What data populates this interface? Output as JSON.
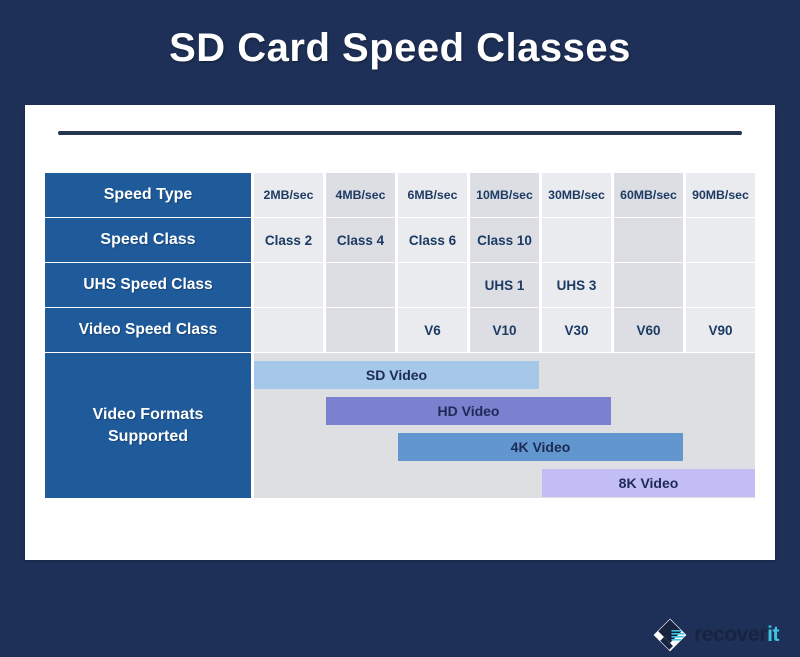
{
  "poster": {
    "title": "SD Card Speed Classes",
    "background_color": "#1e3057",
    "card_color": "#ffffff",
    "rule_color": "#25364d",
    "label_color": "#1f5b9b"
  },
  "table": {
    "rows": [
      {
        "label": "Speed Type",
        "cells": [
          "2MB/sec",
          "4MB/sec",
          "6MB/sec",
          "10MB/sec",
          "30MB/sec",
          "60MB/sec",
          "90MB/sec"
        ]
      },
      {
        "label": "Speed Class",
        "cells": [
          "Class 2",
          "Class 4",
          "Class 6",
          "Class 10",
          "",
          "",
          ""
        ]
      },
      {
        "label": "UHS Speed Class",
        "cells": [
          "",
          "",
          "",
          "UHS 1",
          "UHS 3",
          "",
          ""
        ]
      },
      {
        "label": "Video Speed Class",
        "cells": [
          "",
          "",
          "V6",
          "V10",
          "V30",
          "V60",
          "V90"
        ]
      }
    ]
  },
  "video_formats": {
    "label": "Video Formats\nSupported",
    "label_line1": "Video Formats",
    "label_line2": "Supported",
    "bars": [
      {
        "name": "SD Video",
        "start_col": 1,
        "end_col": 4,
        "color": "#a5c7e8"
      },
      {
        "name": "HD Video",
        "start_col": 2,
        "end_col": 5,
        "color": "#7b80cf"
      },
      {
        "name": "4K Video",
        "start_col": 3,
        "end_col": 6,
        "color": "#6296cf"
      },
      {
        "name": "8K Video",
        "start_col": 5,
        "end_col": 7,
        "color": "#c2bdf5"
      }
    ]
  },
  "logo": {
    "name_primary": "recover",
    "name_accent": "it",
    "mark_color": "#18243f",
    "accent_color": "#3ec6e0"
  },
  "chart_data": {
    "type": "table",
    "title": "SD Card Speed Classes",
    "categories": [
      "2MB/sec",
      "4MB/sec",
      "6MB/sec",
      "10MB/sec",
      "30MB/sec",
      "60MB/sec",
      "90MB/sec"
    ],
    "series": [
      {
        "name": "Speed Class",
        "values": [
          "Class 2",
          "Class 4",
          "Class 6",
          "Class 10",
          "",
          "",
          ""
        ]
      },
      {
        "name": "UHS Speed Class",
        "values": [
          "",
          "",
          "",
          "UHS 1",
          "UHS 3",
          "",
          ""
        ]
      },
      {
        "name": "Video Speed Class",
        "values": [
          "",
          "",
          "V6",
          "V10",
          "V30",
          "V60",
          "V90"
        ]
      }
    ],
    "ranges": [
      {
        "name": "SD Video",
        "from": "2MB/sec",
        "to": "10MB/sec"
      },
      {
        "name": "HD Video",
        "from": "4MB/sec",
        "to": "30MB/sec"
      },
      {
        "name": "4K Video",
        "from": "6MB/sec",
        "to": "60MB/sec"
      },
      {
        "name": "8K Video",
        "from": "30MB/sec",
        "to": "90MB/sec"
      }
    ],
    "xlabel": "Speed Type",
    "ylabel": "",
    "grid": false,
    "legend": "none"
  }
}
